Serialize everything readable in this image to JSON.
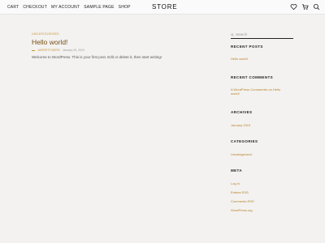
{
  "header": {
    "nav": [
      "Cart",
      "Checkout",
      "My account",
      "Sample Page",
      "Shop"
    ],
    "logo": "STORE",
    "icons": [
      "heart-icon",
      "cart-icon",
      "search-icon"
    ]
  },
  "post": {
    "category": "Uncategorized",
    "title": "Hello world!",
    "author": "jarrettnerd",
    "date": "January 29, 2019",
    "excerpt": "Welcome to WordPress. This is your first post. Edit or delete it, then start writing!"
  },
  "sidebar": {
    "search_placeholder": "Search",
    "recent_posts_title": "Recent Posts",
    "recent_posts": [
      "Hello world!"
    ],
    "recent_comments_title": "Recent Comments",
    "recent_comments": [
      "A WordPress Commenter on Hello world!"
    ],
    "archives_title": "Archives",
    "archives": [
      "January 2019"
    ],
    "categories_title": "Categories",
    "categories": [
      "Uncategorized"
    ],
    "meta_title": "Meta",
    "meta_links": [
      "Log in",
      "Entries RSS",
      "Comments RSS",
      "WordPress.org"
    ]
  },
  "colors": {
    "accent": "#c5902e",
    "title": "#7a4f16",
    "background": "#f3f2f0"
  }
}
